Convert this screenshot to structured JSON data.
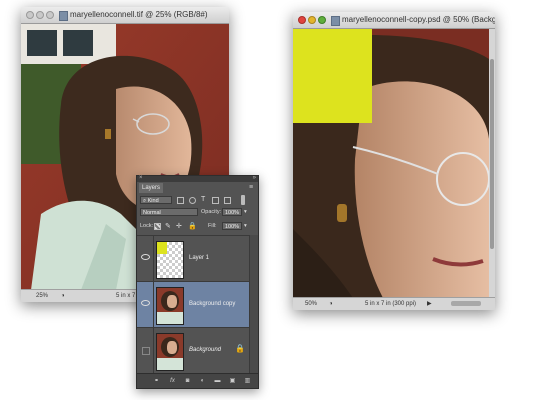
{
  "left_window": {
    "title": "maryellenoconnell.tif @ 25% (RGB/8#)",
    "zoom": "25%",
    "doc_info": "5 in x 7 in (300 ppi)"
  },
  "right_window": {
    "title": "maryellenoconnell-copy.psd @ 50% (Backgro",
    "zoom": "50%",
    "doc_info": "5 in x 7 in (300 ppi)",
    "overlay_color": "#dde31e"
  },
  "layers_panel": {
    "tab_label": "Layers",
    "kind_label": "Kind",
    "blend_mode": "Normal",
    "opacity_label": "Opacity:",
    "opacity_value": "100%",
    "lock_label": "Lock:",
    "fill_label": "Fill:",
    "fill_value": "100%",
    "layers": [
      {
        "name": "Layer 1",
        "visible": true,
        "active": false
      },
      {
        "name": "Background copy",
        "visible": true,
        "active": true
      },
      {
        "name": "Background",
        "visible": false,
        "active": false,
        "locked": true
      }
    ],
    "bottom_icons": [
      "link-icon",
      "fx-icon",
      "mask-icon",
      "adjustment-icon",
      "folder-icon",
      "new-layer-icon",
      "trash-icon"
    ]
  },
  "colors": {
    "panel_bg": "#535353",
    "active_layer": "#6e83a3",
    "yellow": "#dde31e"
  }
}
